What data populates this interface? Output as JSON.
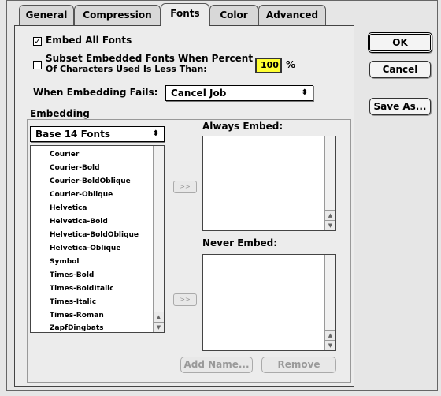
{
  "tabs": [
    {
      "label": "General",
      "active": false
    },
    {
      "label": "Compression",
      "active": false
    },
    {
      "label": "Fonts",
      "active": true
    },
    {
      "label": "Color",
      "active": false
    },
    {
      "label": "Advanced",
      "active": false
    }
  ],
  "options": {
    "embed_all_label": "Embed All Fonts",
    "embed_all_checked": true,
    "subset_label_line1": "Subset Embedded Fonts When Percent",
    "subset_label_line2": "Of Characters Used Is Less Than:",
    "subset_checked": false,
    "percent_value": "100",
    "percent_unit": "%",
    "fail_label": "When Embedding Fails:",
    "fail_value": "Cancel Job"
  },
  "embedding": {
    "title": "Embedding",
    "font_set": "Base 14 Fonts",
    "fonts": [
      "Courier",
      "Courier-Bold",
      "Courier-BoldOblique",
      "Courier-Oblique",
      "Helvetica",
      "Helvetica-Bold",
      "Helvetica-BoldOblique",
      "Helvetica-Oblique",
      "Symbol",
      "Times-Bold",
      "Times-BoldItalic",
      "Times-Italic",
      "Times-Roman",
      "ZapfDingbats"
    ],
    "move_label": ">>",
    "always_embed_label": "Always Embed:",
    "never_embed_label": "Never Embed:",
    "add_name_label": "Add Name...",
    "remove_label": "Remove"
  },
  "buttons": {
    "ok": "OK",
    "cancel": "Cancel",
    "save_as": "Save As..."
  },
  "colors": {
    "percent_bg": "#ffff33"
  }
}
